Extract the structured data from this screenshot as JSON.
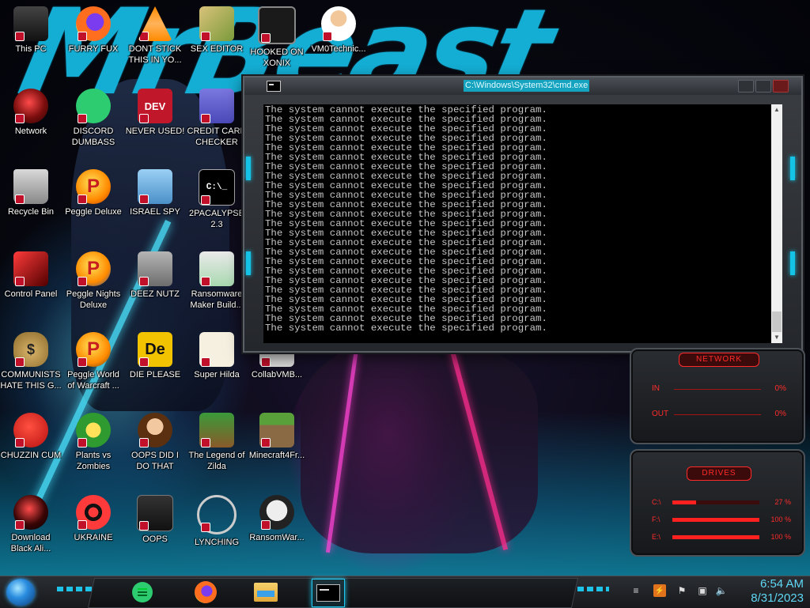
{
  "colors": {
    "accent_cyan": "#14c3e6",
    "gadget_red": "#ff2b2b",
    "cmd_text": "#c6c6c6",
    "cmd_title_highlight": "#15a3c0",
    "clock_text": "#5fd8f5"
  },
  "wallpaper": {
    "title_text": "MrBeast"
  },
  "desktop_icons": [
    {
      "label": "This PC",
      "icon": "monitor-icon"
    },
    {
      "label": "FURRY FUX",
      "icon": "firefox-icon"
    },
    {
      "label": "DONT STICK THIS IN YO...",
      "icon": "vlc-cone-icon"
    },
    {
      "label": "SEX EDITOR",
      "icon": "hxd-editor-icon"
    },
    {
      "label": "HOOKED ON XONIX",
      "icon": "xonix-game-icon"
    },
    {
      "label": "VM0Technic...",
      "icon": "doctor-icon"
    },
    {
      "label": "Network",
      "icon": "network-orb-icon"
    },
    {
      "label": "DISCORD DUMBASS",
      "icon": "discord-chat-icon"
    },
    {
      "label": "NEVER USED!",
      "icon": "devcpp-icon"
    },
    {
      "label": "CREDIT CARD CHECKER",
      "icon": "credit-card-icon"
    },
    {
      "label": "Recycle Bin",
      "icon": "recycle-bin-icon"
    },
    {
      "label": "Peggle Deluxe",
      "icon": "peggle-icon"
    },
    {
      "label": "ISRAEL SPY",
      "icon": "spy-app-icon"
    },
    {
      "label": "2PACALYPSE 2.3",
      "icon": "terminal-icon"
    },
    {
      "label": "Control Panel",
      "icon": "control-panel-icon"
    },
    {
      "label": "Peggle Nights Deluxe",
      "icon": "peggle-nights-icon"
    },
    {
      "label": "DEEZ NUTZ",
      "icon": "stacked-windows-icon"
    },
    {
      "label": "Ransomware Maker Build...",
      "icon": "ransomware-app-icon"
    },
    {
      "label": "COMMUNISTS HATE THIS G...",
      "icon": "money-bag-icon"
    },
    {
      "label": "Peggle World of Warcraft ...",
      "icon": "peggle-wow-icon"
    },
    {
      "label": "DIE PLEASE",
      "icon": "de-icon"
    },
    {
      "label": "Super Hilda",
      "icon": "pixel-character-icon"
    },
    {
      "label": "CollabVMB...",
      "icon": "collabvm-icon"
    },
    {
      "label": "CHUZZIN CUM",
      "icon": "chuzzle-icon"
    },
    {
      "label": "Plants vs Zombies",
      "icon": "pvz-icon"
    },
    {
      "label": "OOPS DID I DO THAT",
      "icon": "portrait-icon"
    },
    {
      "label": "The Legend of Zilda",
      "icon": "zelda-pixel-icon"
    },
    {
      "label": "Minecraft4Fr...",
      "icon": "minecraft-block-icon"
    },
    {
      "label": "Download Black Ali...",
      "icon": "black-orb-icon"
    },
    {
      "label": "UKRAINE",
      "icon": "radiation-icon"
    },
    {
      "label": "OOPS",
      "icon": "book-icon"
    },
    {
      "label": "LYNCHING",
      "icon": "chain-icon"
    },
    {
      "label": "RansomWar...",
      "icon": "skull-icon"
    }
  ],
  "cmd_window": {
    "title": "C:\\Windows\\System32\\cmd.exe",
    "line": "The system cannot execute the specified program.",
    "line_count": 24
  },
  "network_gadget": {
    "title": "NETWORK",
    "in_label": "IN",
    "in_value": "0%",
    "out_label": "OUT",
    "out_value": "0%"
  },
  "drives_gadget": {
    "title": "DRIVES",
    "drives": [
      {
        "label": "C:\\",
        "value_text": "27 %",
        "fraction": 0.27
      },
      {
        "label": "F:\\",
        "value_text": "100 %",
        "fraction": 1.0
      },
      {
        "label": "E:\\",
        "value_text": "100 %",
        "fraction": 1.0
      }
    ]
  },
  "taskbar": {
    "apps": [
      {
        "name": "discord-chat-icon"
      },
      {
        "name": "firefox-icon"
      },
      {
        "name": "file-explorer-icon"
      },
      {
        "name": "cmd-icon",
        "active": true
      }
    ],
    "tray_icons": [
      "show-hidden-icon",
      "notification-app-icon",
      "flag-icon",
      "network-icon",
      "volume-icon"
    ],
    "time": "6:54 AM",
    "date": "8/31/2023"
  }
}
